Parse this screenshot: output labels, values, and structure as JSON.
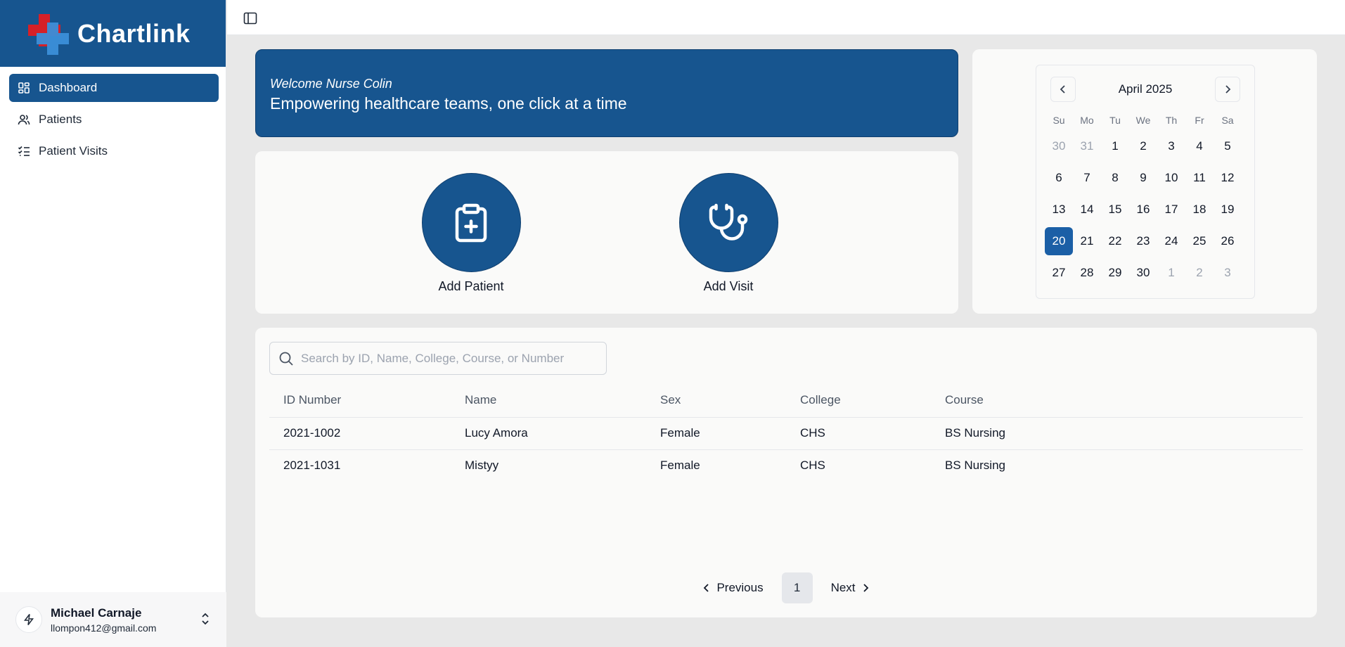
{
  "brand": {
    "name": "Chartlink",
    "primary": "#17558f",
    "accent": "#d62027"
  },
  "nav": {
    "items": [
      {
        "label": "Dashboard",
        "icon": "dashboard-icon",
        "active": true
      },
      {
        "label": "Patients",
        "icon": "users-icon",
        "active": false
      },
      {
        "label": "Patient Visits",
        "icon": "checklist-icon",
        "active": false
      }
    ]
  },
  "user": {
    "name": "Michael Carnaje",
    "email": "llompon412@gmail.com"
  },
  "welcome": {
    "greeting": "Welcome Nurse Colin",
    "tagline": "Empowering healthcare teams, one click at a time"
  },
  "actions": {
    "add_patient": "Add Patient",
    "add_visit": "Add Visit"
  },
  "calendar": {
    "month_label": "April 2025",
    "weekdays": [
      "Su",
      "Mo",
      "Tu",
      "We",
      "Th",
      "Fr",
      "Sa"
    ],
    "days": [
      {
        "d": "30",
        "muted": true
      },
      {
        "d": "31",
        "muted": true
      },
      {
        "d": "1"
      },
      {
        "d": "2"
      },
      {
        "d": "3"
      },
      {
        "d": "4"
      },
      {
        "d": "5"
      },
      {
        "d": "6"
      },
      {
        "d": "7"
      },
      {
        "d": "8"
      },
      {
        "d": "9"
      },
      {
        "d": "10"
      },
      {
        "d": "11"
      },
      {
        "d": "12"
      },
      {
        "d": "13"
      },
      {
        "d": "14"
      },
      {
        "d": "15"
      },
      {
        "d": "16"
      },
      {
        "d": "17"
      },
      {
        "d": "18"
      },
      {
        "d": "19"
      },
      {
        "d": "20",
        "selected": true
      },
      {
        "d": "21"
      },
      {
        "d": "22"
      },
      {
        "d": "23"
      },
      {
        "d": "24"
      },
      {
        "d": "25"
      },
      {
        "d": "26"
      },
      {
        "d": "27"
      },
      {
        "d": "28"
      },
      {
        "d": "29"
      },
      {
        "d": "30"
      },
      {
        "d": "1",
        "muted": true
      },
      {
        "d": "2",
        "muted": true
      },
      {
        "d": "3",
        "muted": true
      }
    ]
  },
  "search": {
    "placeholder": "Search by ID, Name, College, Course, or Number",
    "value": ""
  },
  "table": {
    "columns": [
      "ID Number",
      "Name",
      "Sex",
      "College",
      "Course"
    ],
    "rows": [
      [
        "2021-1002",
        "Lucy Amora",
        "Female",
        "CHS",
        "BS Nursing"
      ],
      [
        "2021-1031",
        "Mistyy",
        "Female",
        "CHS",
        "BS Nursing"
      ]
    ]
  },
  "pagination": {
    "previous": "Previous",
    "current": "1",
    "next": "Next"
  }
}
